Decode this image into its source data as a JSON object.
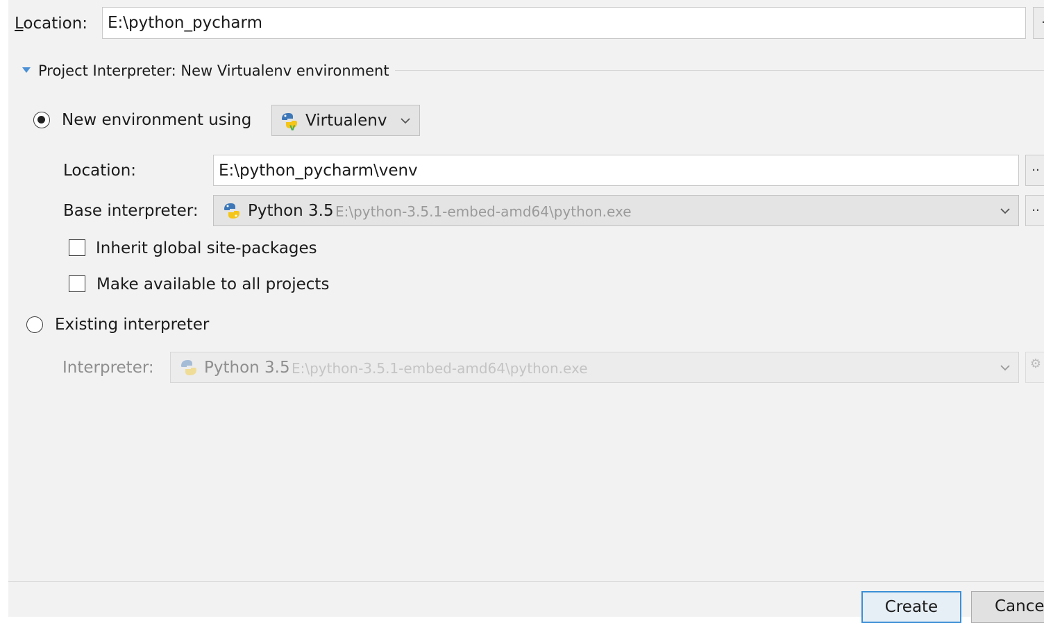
{
  "project_location": {
    "label_access_key": "L",
    "label_rest": "ocation:",
    "value": "E:\\python_pycharm"
  },
  "interpreter_section": {
    "title": "Project Interpreter: New Virtualenv environment",
    "expanded": true
  },
  "new_environment": {
    "radio_label": "New environment using",
    "selected": true,
    "tool_combo": {
      "selected": "Virtualenv",
      "icon": "virtualenv-python-icon"
    },
    "location": {
      "label": "Location:",
      "value": "E:\\python_pycharm\\venv",
      "browse_label": ".."
    },
    "base_interpreter": {
      "label": "Base interpreter:",
      "name": "Python 3.5",
      "path": "E:\\python-3.5.1-embed-amd64\\python.exe",
      "browse_label": ".."
    },
    "inherit_checkbox": {
      "label": "Inherit global site-packages",
      "checked": false
    },
    "make_available_checkbox": {
      "label": "Make available to all projects",
      "checked": false
    }
  },
  "existing_interpreter": {
    "radio_label": "Existing interpreter",
    "selected": false,
    "interpreter": {
      "label": "Interpreter:",
      "name": "Python 3.5",
      "path": "E:\\python-3.5.1-embed-amd64\\python.exe",
      "enabled": false
    }
  },
  "buttons": {
    "create": "Create",
    "cancel": "Cance"
  },
  "colors": {
    "panel_bg": "#f2f2f2",
    "accent_blue": "#3b8fd6",
    "disabled_text": "#8e8e8e"
  }
}
